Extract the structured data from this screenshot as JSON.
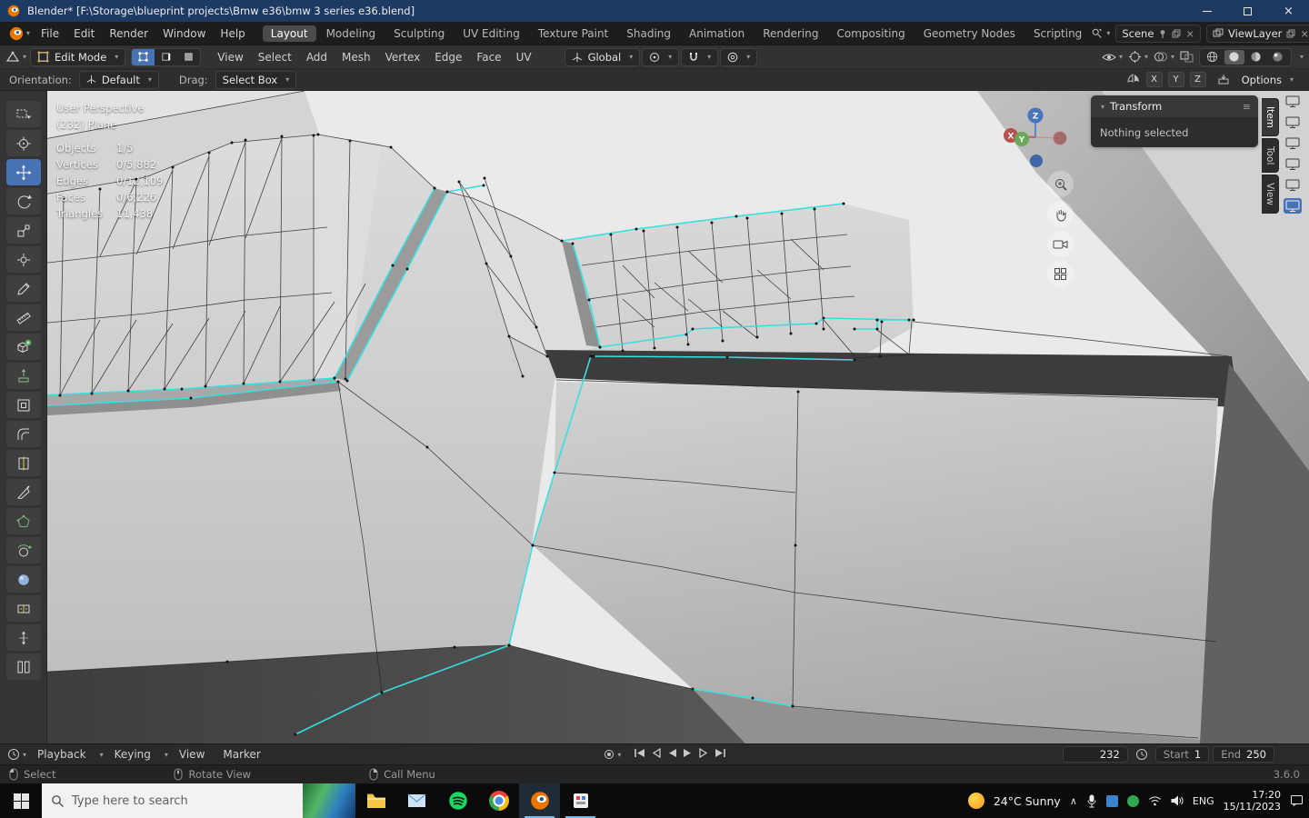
{
  "window": {
    "title": "Blender* [F:\\Storage\\blueprint projects\\Bmw e36\\bmw 3 series e36.blend]"
  },
  "topbar": {
    "menus": [
      "File",
      "Edit",
      "Render",
      "Window",
      "Help"
    ],
    "workspaces": [
      "Layout",
      "Modeling",
      "Sculpting",
      "UV Editing",
      "Texture Paint",
      "Shading",
      "Animation",
      "Rendering",
      "Compositing",
      "Geometry Nodes",
      "Scripting"
    ],
    "scene": "Scene",
    "view_layer": "ViewLayer"
  },
  "tool_header": {
    "mode": "Edit Mode",
    "menus": [
      "View",
      "Select",
      "Add",
      "Mesh",
      "Vertex",
      "Edge",
      "Face",
      "UV"
    ],
    "orientation": "Global"
  },
  "options_row": {
    "orientation_label": "Orientation:",
    "orientation_value": "Default",
    "drag_label": "Drag:",
    "drag_value": "Select Box",
    "axes": [
      "X",
      "Y",
      "Z"
    ],
    "options": "Options"
  },
  "viewport": {
    "view_name": "User Perspective",
    "object_name": "(232) Plane",
    "stats": [
      {
        "label": "Objects",
        "value": "1/5"
      },
      {
        "label": "Vertices",
        "value": "0/5,882"
      },
      {
        "label": "Edges",
        "value": "0/12,109"
      },
      {
        "label": "Faces",
        "value": "0/6,226"
      },
      {
        "label": "Triangles",
        "value": "11,438"
      }
    ],
    "transform_panel": {
      "title": "Transform",
      "message": "Nothing selected"
    },
    "sidebar_tabs": [
      "Item",
      "Tool",
      "View"
    ],
    "gizmo": {
      "x": "X",
      "y": "Y",
      "z": "Z"
    }
  },
  "timeline": {
    "menus": [
      "Playback",
      "Keying",
      "View",
      "Marker"
    ],
    "current_frame": "232",
    "start_label": "Start",
    "start_value": "1",
    "end_label": "End",
    "end_value": "250"
  },
  "statusbar": {
    "hints": [
      "Select",
      "Rotate View",
      "Call Menu"
    ],
    "version": "3.6.0"
  },
  "taskbar": {
    "search_placeholder": "Type here to search",
    "weather": "24°C Sunny",
    "language": "ENG",
    "time": "17:20",
    "date": "15/11/2023"
  },
  "colors": {
    "selected_edge": "#38dfdf",
    "active_tool": "#4772b3",
    "titlebar": "#1d3a63"
  }
}
